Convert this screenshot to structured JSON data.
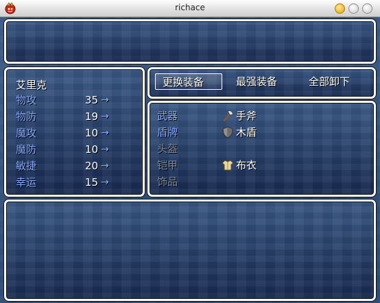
{
  "window": {
    "title": "richace",
    "buttons": [
      "minimize-icon",
      "zoom-icon",
      "close-icon"
    ]
  },
  "help": {
    "text": ""
  },
  "actor": {
    "name": "艾里克",
    "stats": [
      {
        "label": "物攻",
        "value": "35",
        "arrow": "→"
      },
      {
        "label": "物防",
        "value": "19",
        "arrow": "→"
      },
      {
        "label": "魔攻",
        "value": "10",
        "arrow": "→"
      },
      {
        "label": "魔防",
        "value": "10",
        "arrow": "→"
      },
      {
        "label": "敏捷",
        "value": "20",
        "arrow": "→"
      },
      {
        "label": "幸运",
        "value": "15",
        "arrow": "→"
      }
    ]
  },
  "commands": [
    {
      "label": "更换装备",
      "selected": true
    },
    {
      "label": "最强装备",
      "selected": false
    },
    {
      "label": "全部卸下",
      "selected": false
    }
  ],
  "equipment": [
    {
      "slot": "武器",
      "item": "手斧",
      "icon": "axe-icon",
      "slot_enabled": true
    },
    {
      "slot": "盾牌",
      "item": "木盾",
      "icon": "shield-icon",
      "slot_enabled": true
    },
    {
      "slot": "头盔",
      "item": "",
      "icon": "",
      "slot_enabled": false
    },
    {
      "slot": "铠甲",
      "item": "布衣",
      "icon": "cloth-armor-icon",
      "slot_enabled": false
    },
    {
      "slot": "饰品",
      "item": "",
      "icon": "",
      "slot_enabled": false
    }
  ],
  "colors": {
    "system_text": "#84a9ff",
    "normal_text": "#ffffff",
    "disabled_text": "#7f8aa3",
    "window_border": "#ffffff",
    "window_fill": "#22406e"
  }
}
